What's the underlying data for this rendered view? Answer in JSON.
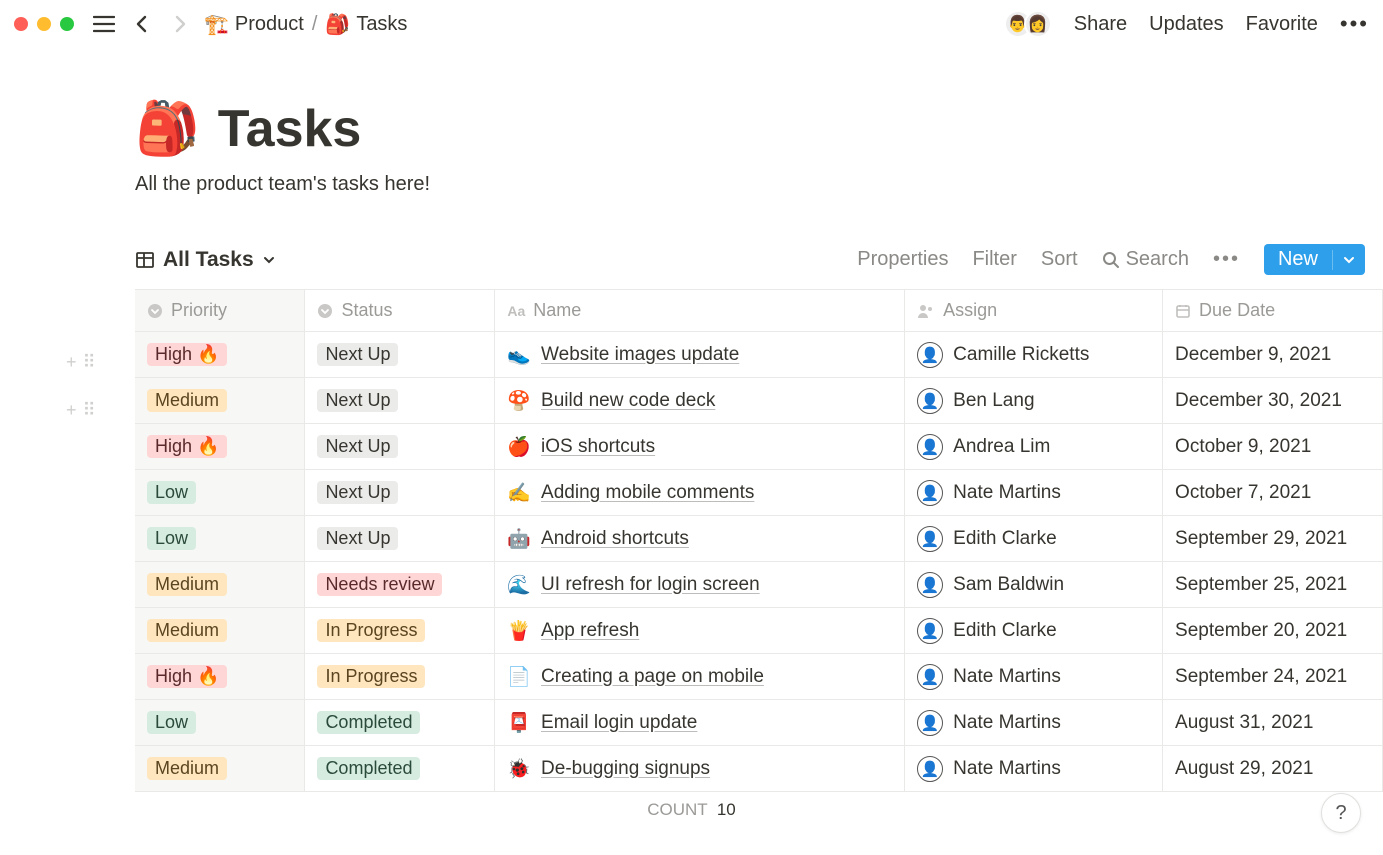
{
  "breadcrumb": {
    "parent_icon": "🏗️",
    "parent_label": "Product",
    "current_icon": "🎒",
    "current_label": "Tasks"
  },
  "topbar": {
    "share": "Share",
    "updates": "Updates",
    "favorite": "Favorite"
  },
  "page": {
    "icon": "🎒",
    "title": "Tasks",
    "description": "All the product team's tasks here!"
  },
  "view": {
    "name": "All Tasks",
    "properties": "Properties",
    "filter": "Filter",
    "sort": "Sort",
    "search": "Search",
    "new": "New"
  },
  "columns": {
    "priority": "Priority",
    "status": "Status",
    "name": "Name",
    "assign": "Assign",
    "due": "Due Date"
  },
  "rows": [
    {
      "priority": "High 🔥",
      "priority_class": "high",
      "status": "Next Up",
      "status_class": "nextup",
      "icon": "👟",
      "name": "Website images update",
      "assign": "Camille Ricketts",
      "due": "December 9, 2021"
    },
    {
      "priority": "Medium",
      "priority_class": "medium",
      "status": "Next Up",
      "status_class": "nextup",
      "icon": "🍄",
      "name": "Build new code deck",
      "assign": "Ben Lang",
      "due": "December 30, 2021"
    },
    {
      "priority": "High 🔥",
      "priority_class": "high",
      "status": "Next Up",
      "status_class": "nextup",
      "icon": "🍎",
      "name": "iOS shortcuts",
      "assign": "Andrea Lim",
      "due": "October 9, 2021"
    },
    {
      "priority": "Low",
      "priority_class": "low",
      "status": "Next Up",
      "status_class": "nextup",
      "icon": "✍️",
      "name": "Adding mobile comments",
      "assign": "Nate Martins",
      "due": "October 7, 2021"
    },
    {
      "priority": "Low",
      "priority_class": "low",
      "status": "Next Up",
      "status_class": "nextup",
      "icon": "🤖",
      "name": "Android shortcuts",
      "assign": "Edith Clarke",
      "due": "September 29, 2021"
    },
    {
      "priority": "Medium",
      "priority_class": "medium",
      "status": "Needs review",
      "status_class": "needsreview",
      "icon": "🌊",
      "name": "UI refresh for login screen",
      "assign": "Sam Baldwin",
      "due": "September 25, 2021"
    },
    {
      "priority": "Medium",
      "priority_class": "medium",
      "status": "In Progress",
      "status_class": "inprogress",
      "icon": "🍟",
      "name": "App refresh",
      "assign": "Edith Clarke",
      "due": "September 20, 2021"
    },
    {
      "priority": "High 🔥",
      "priority_class": "high",
      "status": "In Progress",
      "status_class": "inprogress",
      "icon": "📄",
      "name": "Creating a page on mobile",
      "assign": "Nate Martins",
      "due": "September 24, 2021"
    },
    {
      "priority": "Low",
      "priority_class": "low",
      "status": "Completed",
      "status_class": "completed",
      "icon": "📮",
      "name": "Email login update",
      "assign": "Nate Martins",
      "due": "August 31, 2021"
    },
    {
      "priority": "Medium",
      "priority_class": "medium",
      "status": "Completed",
      "status_class": "completed",
      "icon": "🐞",
      "name": "De-bugging signups",
      "assign": "Nate Martins",
      "due": "August 29, 2021"
    }
  ],
  "footer": {
    "count_label": "COUNT",
    "count_value": "10"
  },
  "help": "?"
}
